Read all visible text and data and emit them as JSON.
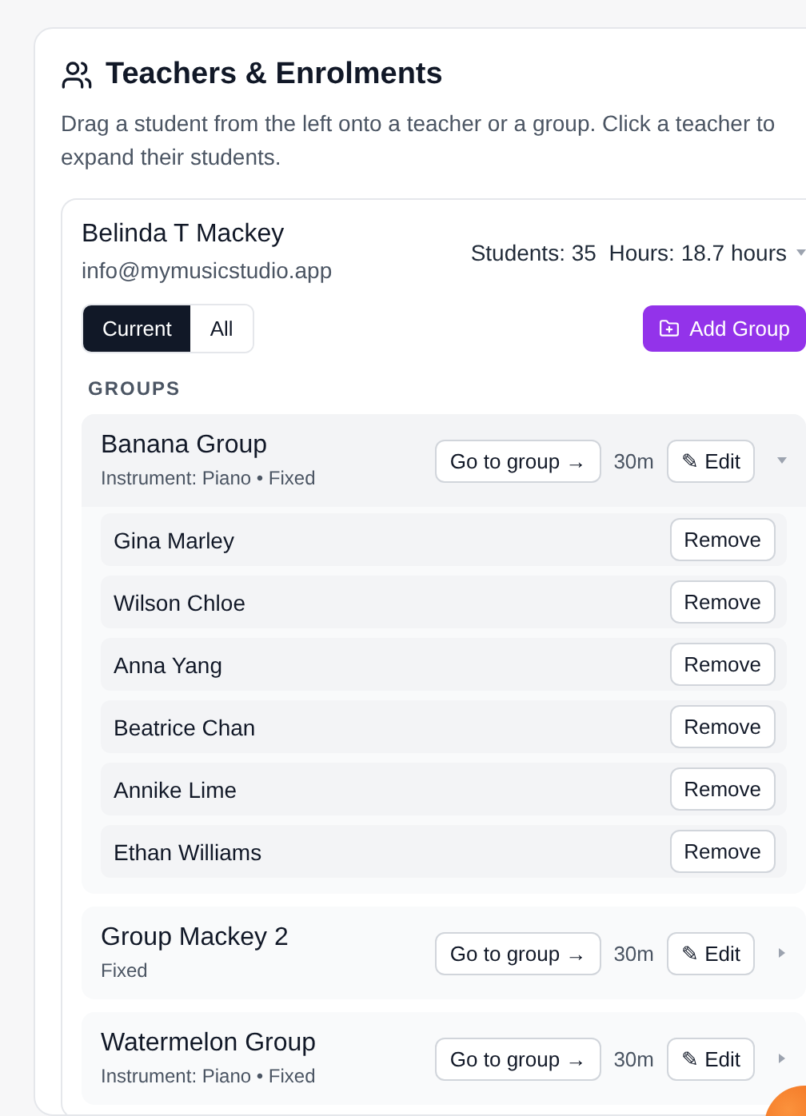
{
  "panel": {
    "title": "Teachers & Enrolments",
    "description": "Drag a student from the left onto a teacher or a group. Click a teacher to expand their students."
  },
  "teacher": {
    "name": "Belinda T Mackey",
    "email": "info@mymusicstudio.app",
    "stats": "Students: 35  Hours: 18.7 hours",
    "expanded": true,
    "filters": [
      {
        "label": "Current",
        "selected": true
      },
      {
        "label": "All",
        "selected": false
      }
    ],
    "add_group": "Add Group",
    "groups_label": "GROUPS",
    "groups": [
      {
        "name": "Banana Group",
        "meta": "Instrument: Piano • Fixed",
        "go": "Go to group →",
        "duration": "30m",
        "edit": "✎ Edit",
        "expanded": true,
        "students": [
          {
            "name": "Gina Marley",
            "action": "Remove"
          },
          {
            "name": "Wilson Chloe",
            "action": "Remove"
          },
          {
            "name": "Anna Yang",
            "action": "Remove"
          },
          {
            "name": "Beatrice Chan",
            "action": "Remove"
          },
          {
            "name": "Annike Lime",
            "action": "Remove"
          },
          {
            "name": "Ethan Williams",
            "action": "Remove"
          }
        ]
      },
      {
        "name": "Group Mackey 2",
        "meta": "Fixed",
        "go": "Go to group →",
        "duration": "30m",
        "edit": "✎ Edit",
        "expanded": false
      },
      {
        "name": "Watermelon Group",
        "meta": "Instrument: Piano • Fixed",
        "go": "Go to group →",
        "duration": "30m",
        "edit": "✎ Edit",
        "expanded": false
      }
    ]
  }
}
